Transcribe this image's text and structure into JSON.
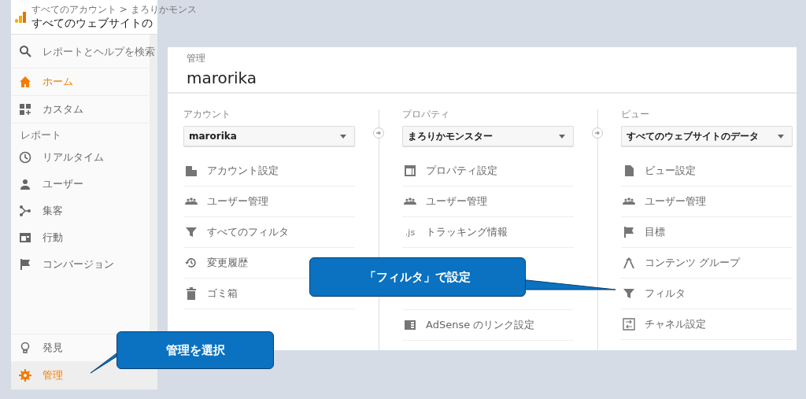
{
  "sidebar": {
    "breadcrumb": "すべてのアカウント > まろりかモンス",
    "title": "すべてのウェブサイトの",
    "search": {
      "placeholder": "レポートとヘルプを検索"
    },
    "top_items": [
      {
        "label": "ホーム",
        "highlighted": true,
        "selected": false
      },
      {
        "label": "カスタム",
        "highlighted": false,
        "selected": false
      }
    ],
    "section": "レポート",
    "report_items": [
      {
        "label": "リアルタイム",
        "highlighted": false,
        "selected": false
      },
      {
        "label": "ユーザー",
        "highlighted": false,
        "selected": false
      },
      {
        "label": "集客",
        "highlighted": false,
        "selected": false
      },
      {
        "label": "行動",
        "highlighted": false,
        "selected": false
      },
      {
        "label": "コンバージョン",
        "highlighted": false,
        "selected": false
      }
    ],
    "bottom_items": [
      {
        "label": "発見",
        "highlighted": false,
        "selected": false
      },
      {
        "label": "管理",
        "highlighted": true,
        "selected": true
      }
    ]
  },
  "admin": {
    "caption": "管理",
    "title": "marorika",
    "columns": [
      {
        "heading": "アカウント",
        "dropdown": "marorika",
        "groups": [
          [
            "アカウント設定",
            "ユーザー管理",
            "すべてのフィルタ",
            "変更履歴",
            "ゴミ箱"
          ]
        ]
      },
      {
        "heading": "プロパティ",
        "dropdown": "まろりかモンスター",
        "groups": [
          [
            "プロパティ設定",
            "ユーザー管理",
            {
              "label": "トラッキング情報",
              "icon_text": ".js"
            }
          ],
          [
            "AdSense のリンク設定"
          ]
        ]
      },
      {
        "heading": "ビュー",
        "dropdown": "すべてのウェブサイトのデータ",
        "groups": [
          [
            "ビュー設定",
            "ユーザー管理",
            "目標",
            "コンテンツ グループ",
            "フィルタ",
            "チャネル設定"
          ]
        ]
      }
    ]
  },
  "callouts": [
    {
      "text": "管理を選択"
    },
    {
      "text": "「フィルタ」で設定"
    }
  ]
}
